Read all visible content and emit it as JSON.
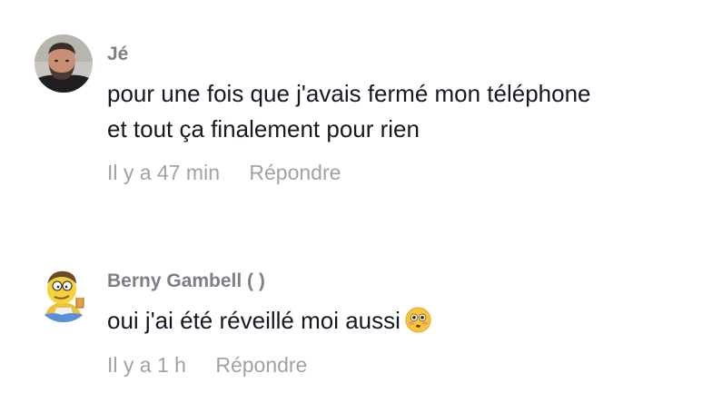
{
  "comments": [
    {
      "username": "Jé",
      "text_lines": [
        "pour une fois que j'avais fermé mon téléphone",
        "et tout ça finalement pour rien"
      ],
      "time": "Il y a 47 min",
      "reply_label": "Répondre",
      "avatar_icon": "bearded-man-avatar"
    },
    {
      "username": "Berny Gambell ( )",
      "text_lines": [
        "oui j'ai été réveillé moi aussi"
      ],
      "emoji": "flushed-face-emoji",
      "time": "Il y a 1 h",
      "reply_label": "Répondre",
      "avatar_icon": "cartoon-barney-avatar"
    }
  ],
  "colors": {
    "username": "#7d7f86",
    "text": "#161823",
    "meta": "#a1a2a7"
  }
}
